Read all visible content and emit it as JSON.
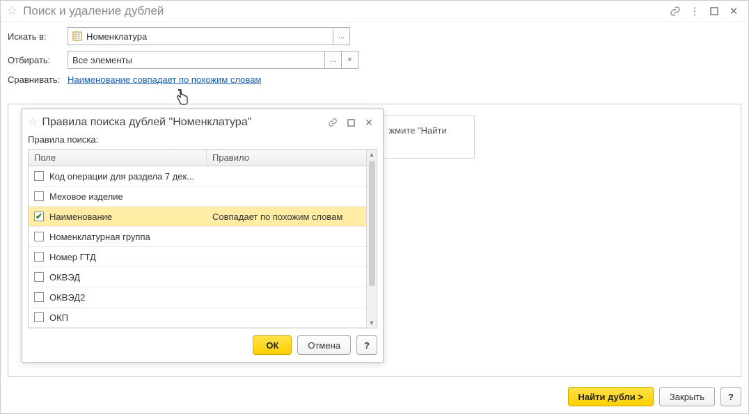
{
  "main": {
    "title": "Поиск и удаление дублей",
    "labels": {
      "search_in": "Искать в:",
      "filter": "Отбирать:",
      "compare": "Сравнивать:"
    },
    "search_in_value": "Номенклатура",
    "filter_value": "Все элементы",
    "compare_link": "Наименование совпадает по похожим словам",
    "ellipsis": "...",
    "clear": "×",
    "hint": "жмите \"Найти дубли\".",
    "buttons": {
      "find": "Найти дубли >",
      "close": "Закрыть",
      "help": "?"
    }
  },
  "dialog": {
    "title": "Правила поиска дублей \"Номенклатура\"",
    "subtitle": "Правила поиска:",
    "columns": {
      "field": "Поле",
      "rule": "Правило"
    },
    "rows": [
      {
        "checked": false,
        "field": "Код операции для раздела 7 дек...",
        "rule": ""
      },
      {
        "checked": false,
        "field": "Меховое изделие",
        "rule": ""
      },
      {
        "checked": true,
        "field": "Наименование",
        "rule": "Совпадает по похожим словам"
      },
      {
        "checked": false,
        "field": "Номенклатурная группа",
        "rule": ""
      },
      {
        "checked": false,
        "field": "Номер ГТД",
        "rule": ""
      },
      {
        "checked": false,
        "field": "ОКВЭД",
        "rule": ""
      },
      {
        "checked": false,
        "field": "ОКВЭД2",
        "rule": ""
      },
      {
        "checked": false,
        "field": "ОКП",
        "rule": ""
      }
    ],
    "buttons": {
      "ok": "ОК",
      "cancel": "Отмена",
      "help": "?"
    }
  }
}
